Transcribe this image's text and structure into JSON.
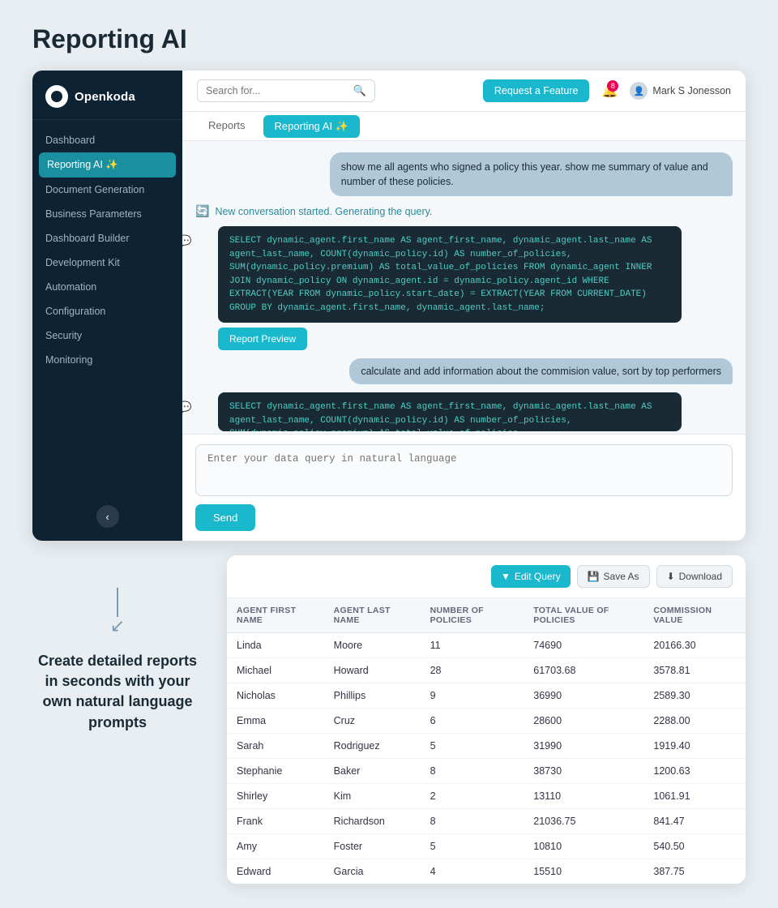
{
  "page": {
    "title": "Reporting AI"
  },
  "topbar": {
    "search_placeholder": "Search for...",
    "feature_button": "Request a Feature",
    "notifications_count": "8",
    "user_name": "Mark S Jonesson"
  },
  "tabs": [
    {
      "id": "reports",
      "label": "Reports",
      "active": false
    },
    {
      "id": "reporting-ai",
      "label": "Reporting AI ✨",
      "active": true
    }
  ],
  "sidebar": {
    "logo_text": "Openkoda",
    "nav_items": [
      {
        "id": "dashboard",
        "label": "Dashboard",
        "active": false
      },
      {
        "id": "reporting-ai",
        "label": "Reporting AI ✨",
        "active": true
      },
      {
        "id": "document-gen",
        "label": "Document Generation",
        "active": false
      },
      {
        "id": "business-params",
        "label": "Business Parameters",
        "active": false
      },
      {
        "id": "dashboard-builder",
        "label": "Dashboard Builder",
        "active": false
      },
      {
        "id": "dev-kit",
        "label": "Development Kit",
        "active": false
      },
      {
        "id": "automation",
        "label": "Automation",
        "active": false
      },
      {
        "id": "configuration",
        "label": "Configuration",
        "active": false
      },
      {
        "id": "security",
        "label": "Security",
        "active": false
      },
      {
        "id": "monitoring",
        "label": "Monitoring",
        "active": false
      }
    ],
    "collapse_icon": "‹"
  },
  "chat": {
    "user_msg_1": "show me all agents who signed a policy this year. show me summary of value and number of these policies.",
    "system_msg_1": "New conversation started. Generating the query.",
    "code_msg_1": "SELECT dynamic_agent.first_name AS agent_first_name, dynamic_agent.last_name AS agent_last_name, COUNT(dynamic_policy.id) AS number_of_policies, SUM(dynamic_policy.premium) AS total_value_of_policies FROM dynamic_agent INNER JOIN dynamic_policy ON dynamic_agent.id = dynamic_policy.agent_id WHERE EXTRACT(YEAR FROM dynamic_policy.start_date) = EXTRACT(YEAR FROM CURRENT_DATE) GROUP BY dynamic_agent.first_name, dynamic_agent.last_name;",
    "report_preview_btn": "Report Preview",
    "user_msg_2": "calculate and add information about the commision value, sort by top performers",
    "code_msg_2": "SELECT dynamic_agent.first_name AS agent_first_name, dynamic_agent.last_name AS agent_last_name, COUNT(dynamic_policy.id) AS number_of_policies, SUM(dynamic_policy.premium) AS total_value_of_policies,",
    "input_placeholder": "Enter your data query in natural language",
    "send_btn": "Send"
  },
  "results": {
    "edit_btn": "Edit Query",
    "save_btn": "Save As",
    "download_btn": "Download",
    "columns": [
      "AGENT FIRST NAME",
      "AGENT LAST NAME",
      "NUMBER OF POLICIES",
      "TOTAL VALUE OF POLICIES",
      "COMMISSION VALUE"
    ],
    "rows": [
      [
        "Linda",
        "Moore",
        "11",
        "74690",
        "20166.30"
      ],
      [
        "Michael",
        "Howard",
        "28",
        "61703.68",
        "3578.81"
      ],
      [
        "Nicholas",
        "Phillips",
        "9",
        "36990",
        "2589.30"
      ],
      [
        "Emma",
        "Cruz",
        "6",
        "28600",
        "2288.00"
      ],
      [
        "Sarah",
        "Rodriguez",
        "5",
        "31990",
        "1919.40"
      ],
      [
        "Stephanie",
        "Baker",
        "8",
        "38730",
        "1200.63"
      ],
      [
        "Shirley",
        "Kim",
        "2",
        "13110",
        "1061.91"
      ],
      [
        "Frank",
        "Richardson",
        "8",
        "21036.75",
        "841.47"
      ],
      [
        "Amy",
        "Foster",
        "5",
        "10810",
        "540.50"
      ],
      [
        "Edward",
        "Garcia",
        "4",
        "15510",
        "387.75"
      ]
    ]
  },
  "bottom": {
    "label": "Create detailed reports in seconds with your own natural language prompts"
  }
}
